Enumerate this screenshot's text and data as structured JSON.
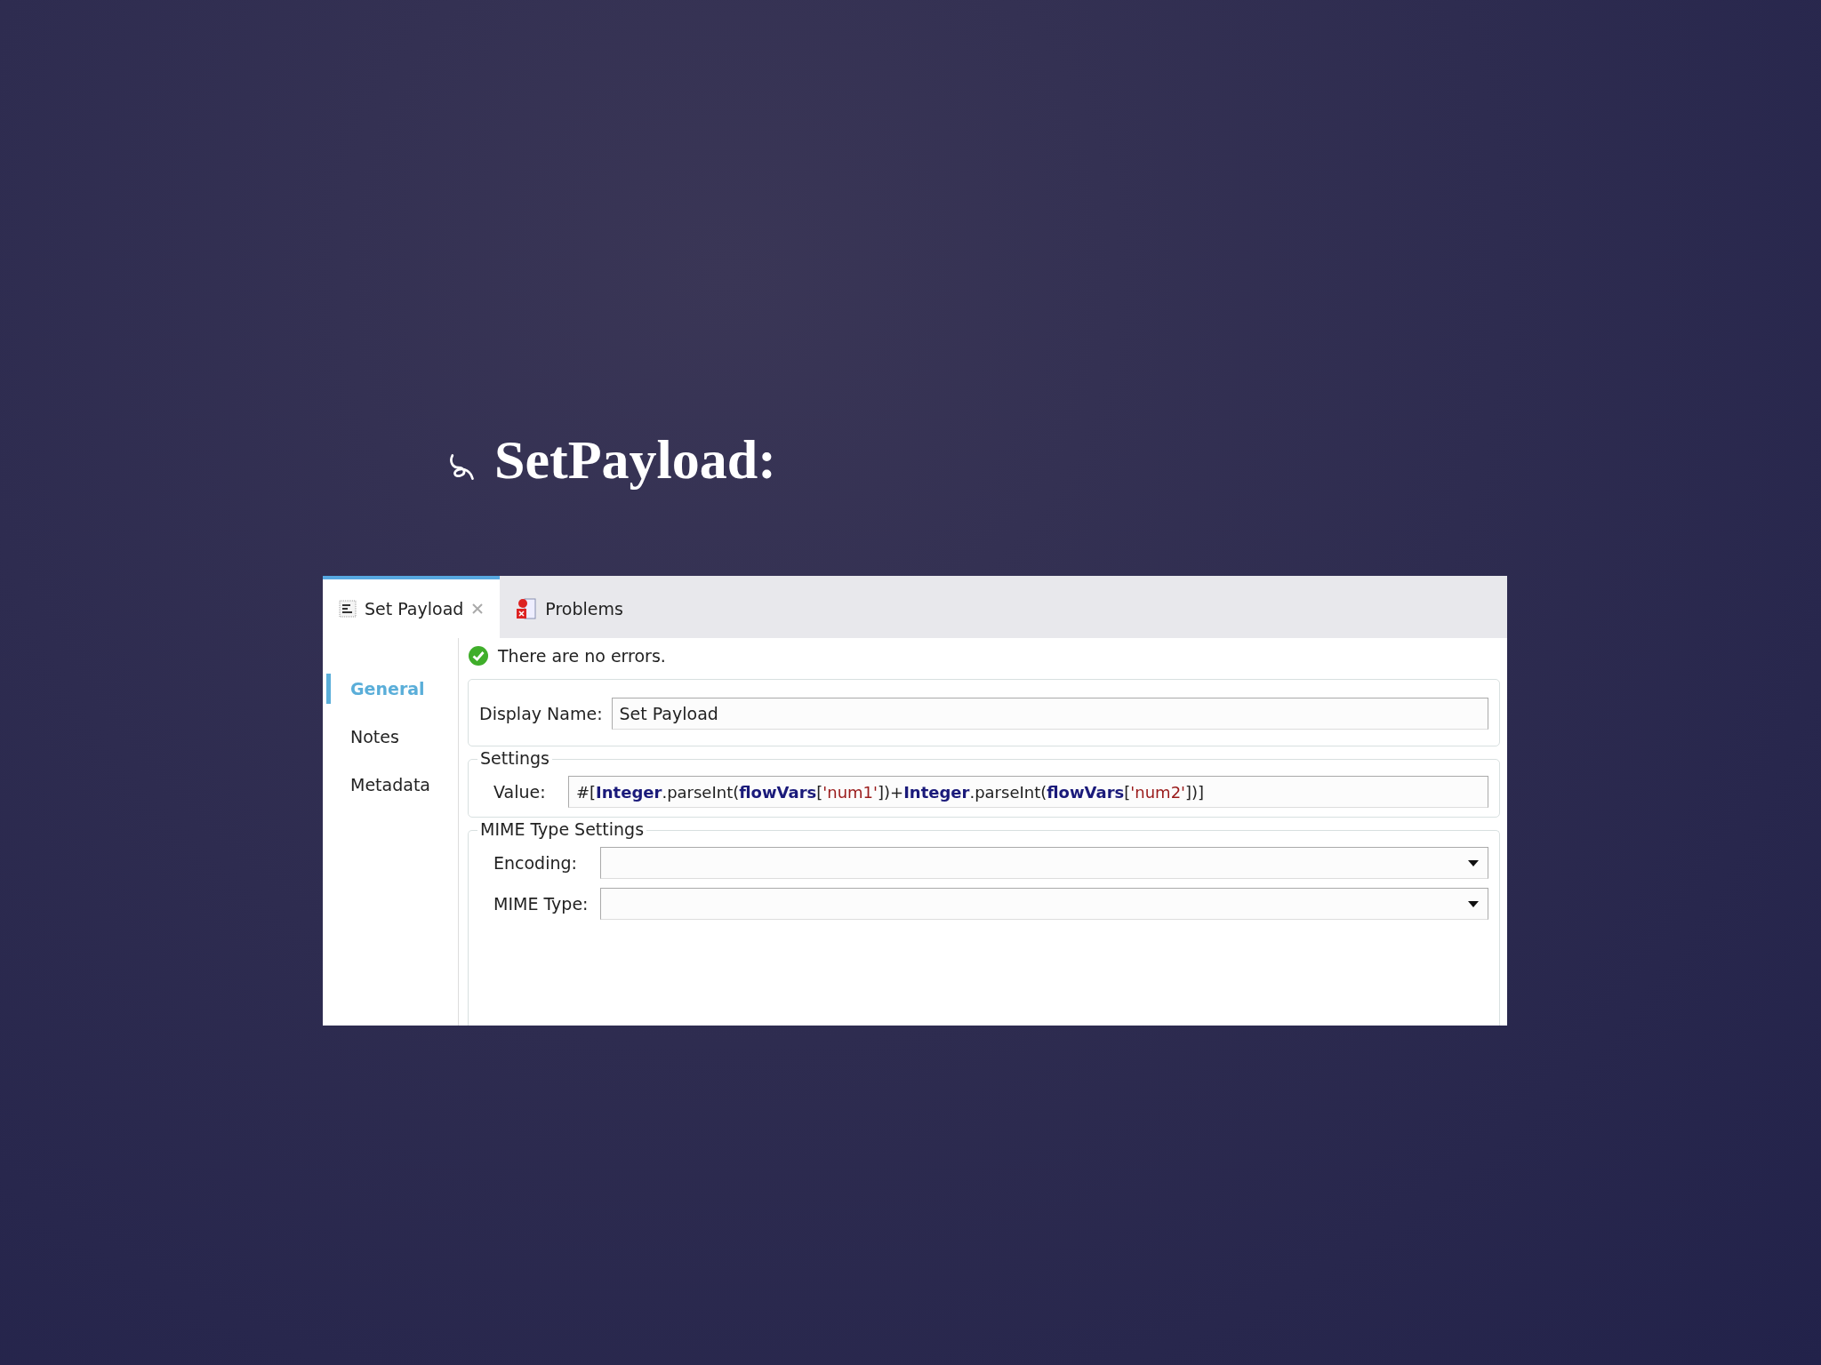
{
  "slide_title": "SetPayload:",
  "tabs": [
    {
      "label": "Set Payload",
      "selected": true,
      "closable": true,
      "kind": "properties"
    },
    {
      "label": "Problems",
      "selected": false,
      "closable": false,
      "kind": "problems"
    }
  ],
  "status_message": "There are no errors.",
  "sidebar": {
    "items": [
      {
        "label": "General",
        "selected": true
      },
      {
        "label": "Notes",
        "selected": false
      },
      {
        "label": "Metadata",
        "selected": false
      }
    ]
  },
  "display_name": {
    "label": "Display Name:",
    "value": "Set Payload"
  },
  "settings": {
    "title": "Settings",
    "label": "Value:",
    "value_segments": [
      {
        "text": "#[",
        "kind": "plain"
      },
      {
        "text": "Integer",
        "kind": "keyword"
      },
      {
        "text": ".parseInt(",
        "kind": "plain"
      },
      {
        "text": "flowVars",
        "kind": "keyword"
      },
      {
        "text": "[",
        "kind": "plain"
      },
      {
        "text": "'num1'",
        "kind": "string"
      },
      {
        "text": "])+",
        "kind": "plain"
      },
      {
        "text": "Integer",
        "kind": "keyword"
      },
      {
        "text": ".parseInt(",
        "kind": "plain"
      },
      {
        "text": "flowVars",
        "kind": "keyword"
      },
      {
        "text": "[",
        "kind": "plain"
      },
      {
        "text": "'num2'",
        "kind": "string"
      },
      {
        "text": "])]",
        "kind": "plain"
      }
    ]
  },
  "mime_settings": {
    "title": "MIME Type Settings",
    "fields": [
      {
        "label": "Encoding:"
      },
      {
        "label": "MIME Type:"
      }
    ]
  }
}
